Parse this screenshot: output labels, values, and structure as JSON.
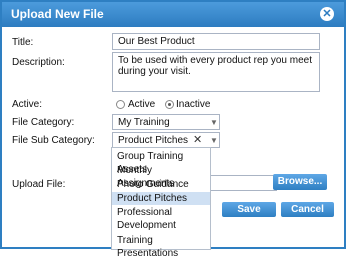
{
  "dialog": {
    "title": "Upload New File"
  },
  "labels": {
    "title": "Title:",
    "description": "Description:",
    "active": "Active:",
    "file_category": "File Category:",
    "file_sub_category": "File Sub Category:",
    "upload_file": "Upload File:"
  },
  "fields": {
    "title_value": "Our Best Product",
    "description_value": "To be used with every product rep you meet during your visit.",
    "active_option_1": "Active",
    "active_option_2": "Inactive",
    "active_selected": "Inactive",
    "file_category_value": "My Training",
    "file_sub_category_value": "Product Pitches"
  },
  "dropdown": {
    "options": [
      "Group Training Assets",
      "Monthly Assignments",
      "Photo Guidance",
      "Product Pitches",
      "Professional",
      "Development",
      "Training Presentations"
    ],
    "highlighted": "Product Pitches"
  },
  "buttons": {
    "browse": "Browse...",
    "save": "Save",
    "cancel": "Cancel"
  },
  "icons": {
    "close": "close-icon",
    "clear": "clear-icon",
    "caret": "chevron-down-icon"
  },
  "colors": {
    "accent": "#2e7fc2",
    "highlight": "#cfe0f3"
  }
}
